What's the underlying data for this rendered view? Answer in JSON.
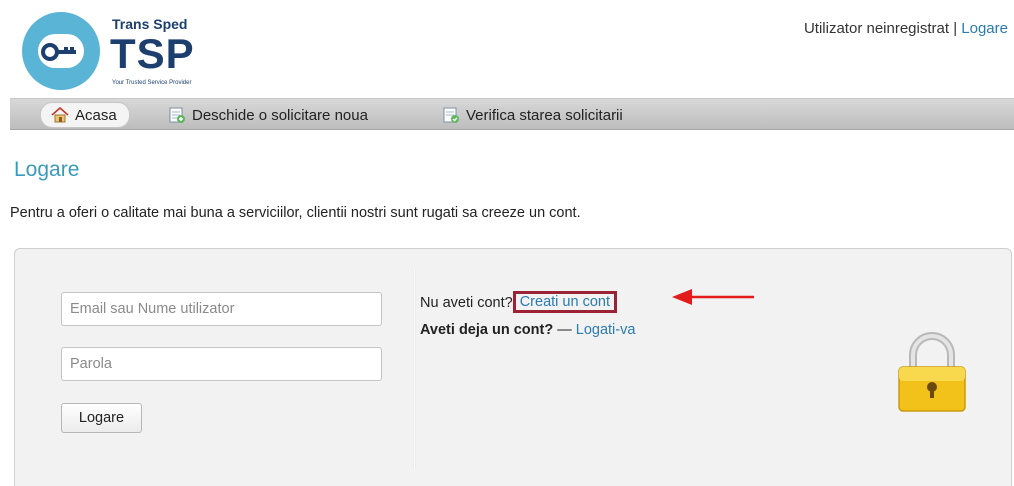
{
  "header": {
    "brand_name": "Trans Sped",
    "brand_short": "TSP",
    "tagline": "Your Trusted Service Provider",
    "user_status": "Utilizator neinregistrat",
    "separator": "|",
    "login_link": "Logare"
  },
  "nav": {
    "items": [
      {
        "label": "Acasa",
        "icon": "home-icon"
      },
      {
        "label": "Deschide o solicitare noua",
        "icon": "new-ticket-icon"
      },
      {
        "label": "Verifica starea solicitarii",
        "icon": "ticket-status-icon"
      }
    ]
  },
  "page": {
    "title": "Logare",
    "intro": "Pentru a oferi o calitate mai buna a serviciilor, clientii nostri sunt rugati sa creeze un cont."
  },
  "form": {
    "email_placeholder": "Email sau Nume utilizator",
    "password_placeholder": "Parola",
    "submit_label": "Logare"
  },
  "signup": {
    "no_account_text": "Nu aveti cont?",
    "create_link": "Creati un cont",
    "have_account_text": "Aveti deja un cont?",
    "dash": "—",
    "login_link": "Logati-va"
  },
  "colors": {
    "accent_blue": "#3a9bbf",
    "link_blue": "#2b7ab0",
    "highlight_red": "#e21b1b",
    "highlight_box": "#9b2335",
    "brand_navy": "#1d3f6e"
  }
}
